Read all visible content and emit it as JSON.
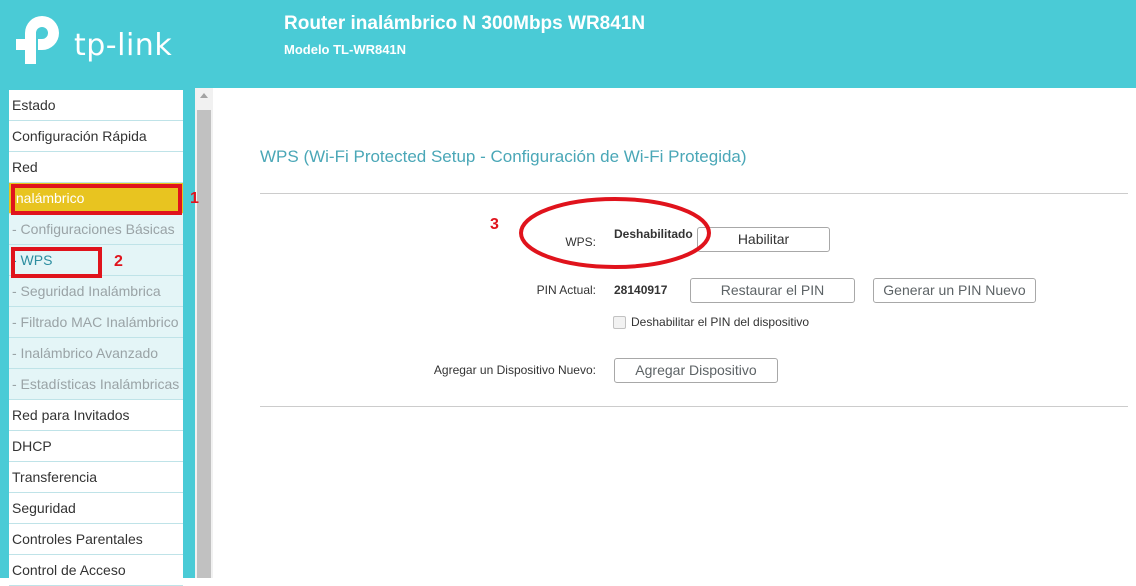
{
  "header": {
    "logo_text": "tp-link",
    "title": "Router inalámbrico N 300Mbps WR841N",
    "model": "Modelo TL-WR841N"
  },
  "sidebar": {
    "items": [
      {
        "label": "Estado"
      },
      {
        "label": "Configuración Rápida"
      },
      {
        "label": "Red"
      },
      {
        "label": "Inalámbrico"
      },
      {
        "label": "- Configuraciones Básicas"
      },
      {
        "label": "- WPS"
      },
      {
        "label": "- Seguridad Inalámbrica"
      },
      {
        "label": "- Filtrado MAC Inalámbrico"
      },
      {
        "label": "- Inalámbrico Avanzado"
      },
      {
        "label": "- Estadísticas Inalámbricas"
      },
      {
        "label": "Red para Invitados"
      },
      {
        "label": "DHCP"
      },
      {
        "label": "Transferencia"
      },
      {
        "label": "Seguridad"
      },
      {
        "label": "Controles Parentales"
      },
      {
        "label": "Control de Acceso"
      }
    ]
  },
  "main": {
    "title": "WPS (Wi-Fi Protected Setup - Configuración de Wi-Fi Protegida)",
    "wps_label": "WPS:",
    "wps_status": "Deshabilitado",
    "enable_button": "Habilitar",
    "pin_label": "PIN Actual:",
    "pin_value": "28140917",
    "restore_pin_button": "Restaurar el PIN",
    "generate_pin_button": "Generar un PIN Nuevo",
    "disable_pin_checkbox_label": "Deshabilitar el PIN del dispositivo",
    "add_device_label": "Agregar un Dispositivo Nuevo:",
    "add_device_button": "Agregar Dispositivo"
  },
  "annotations": {
    "marker_1": "1",
    "marker_2": "2",
    "marker_3": "3"
  },
  "colors": {
    "brand": "#4acbd6",
    "highlight": "#e8c420",
    "annotation": "#e0131c"
  }
}
